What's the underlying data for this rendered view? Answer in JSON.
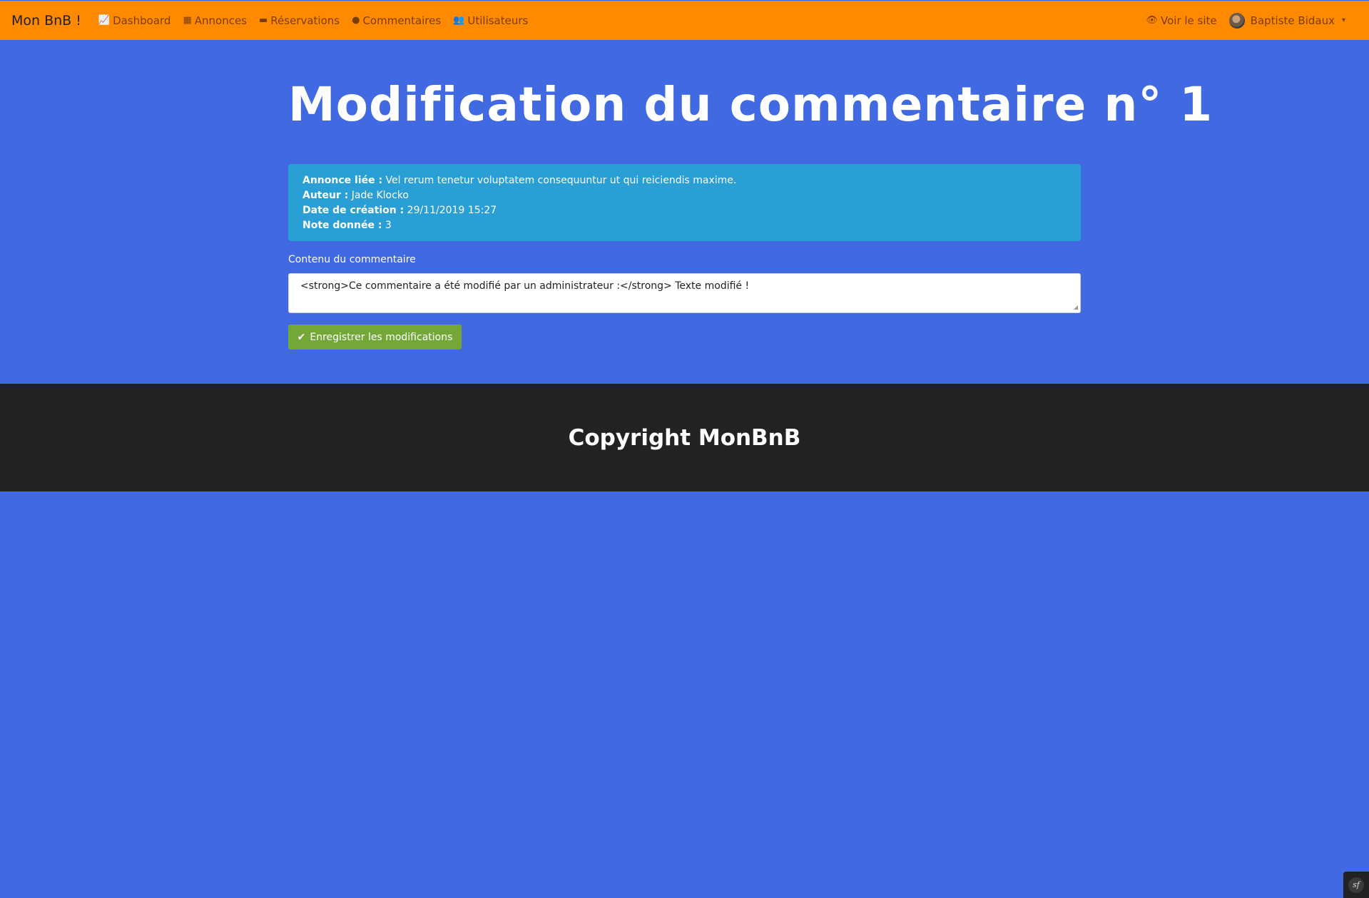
{
  "navbar": {
    "brand": "Mon BnB !",
    "items": [
      {
        "icon": "chart-line-icon",
        "glyph": "📈",
        "label": "Dashboard"
      },
      {
        "icon": "building-icon",
        "glyph": "▦",
        "label": "Annonces"
      },
      {
        "icon": "folder-icon",
        "glyph": "▬",
        "label": "Réservations"
      },
      {
        "icon": "comments-icon",
        "glyph": "●",
        "label": "Commentaires"
      },
      {
        "icon": "users-icon",
        "glyph": "👥",
        "label": "Utilisateurs"
      }
    ],
    "view_site": {
      "icon": "eye-icon",
      "glyph": "👁",
      "label": "Voir le site"
    },
    "user": {
      "name": "Baptiste Bidaux",
      "caret": "▾"
    }
  },
  "main": {
    "title": "Modification du commentaire n° 1",
    "info": {
      "ad_label": "Annonce liée :",
      "ad_value": "Vel rerum tenetur voluptatem consequuntur ut qui reiciendis maxime.",
      "author_label": "Auteur :",
      "author_value": "Jade Klocko",
      "date_label": "Date de création :",
      "date_value": "29/11/2019 15:27",
      "rating_label": "Note donnée :",
      "rating_value": "3"
    },
    "content_label": "Contenu du commentaire",
    "content_value": "<strong>Ce commentaire a été modifié par un administrateur :</strong> Texte modifié !",
    "save_button": {
      "glyph": "✔",
      "label": "Enregistrer les modifications"
    }
  },
  "footer": {
    "text": "Copyright MonBnB"
  },
  "colors": {
    "navbar": "#ff8a00",
    "page_background": "#4169e1",
    "info_box": "#2a9fd6",
    "save_button": "#73a839",
    "footer": "#222222"
  }
}
